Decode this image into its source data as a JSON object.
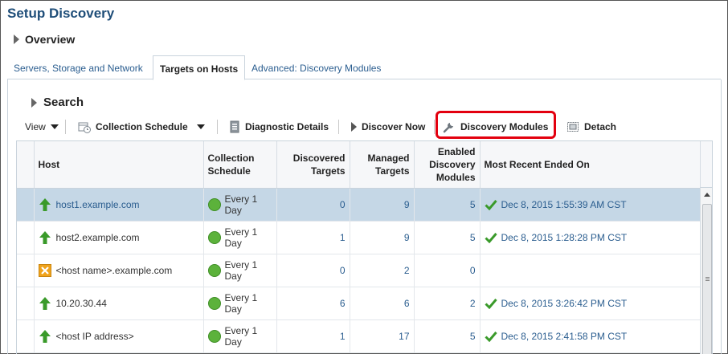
{
  "page": {
    "title": "Setup Discovery"
  },
  "overview": {
    "label": "Overview"
  },
  "tabs": [
    {
      "label": "Servers, Storage and Network"
    },
    {
      "label": "Targets on Hosts"
    },
    {
      "label": "Advanced: Discovery Modules"
    }
  ],
  "search": {
    "label": "Search"
  },
  "toolbar": {
    "view": "View",
    "collection_schedule": "Collection Schedule",
    "diagnostic_details": "Diagnostic Details",
    "discover_now": "Discover Now",
    "discovery_modules": "Discovery Modules",
    "detach": "Detach"
  },
  "table": {
    "headers": {
      "host": "Host",
      "schedule_1": "Collection",
      "schedule_2": "Schedule",
      "discovered_1": "Discovered",
      "discovered_2": "Targets",
      "managed_1": "Managed",
      "managed_2": "Targets",
      "enabled_1": "Enabled",
      "enabled_2": "Discovery",
      "enabled_3": "Modules",
      "recent": "Most Recent Ended On"
    },
    "rows": [
      {
        "status": "up",
        "host": "host1.example.com",
        "schedule_1": "Every 1",
        "schedule_2": "Day",
        "discovered": "0",
        "managed": "9",
        "enabled": "5",
        "recent": "Dec 8, 2015 1:55:39 AM CST"
      },
      {
        "status": "up",
        "host": "host2.example.com",
        "schedule_1": "Every 1",
        "schedule_2": "Day",
        "discovered": "1",
        "managed": "9",
        "enabled": "5",
        "recent": "Dec 8, 2015 1:28:28 PM CST"
      },
      {
        "status": "unknown",
        "host": "<host name>.example.com",
        "schedule_1": "Every 1",
        "schedule_2": "Day",
        "discovered": "0",
        "managed": "2",
        "enabled": "0",
        "recent": ""
      },
      {
        "status": "up",
        "host": "10.20.30.44",
        "schedule_1": "Every 1",
        "schedule_2": "Day",
        "discovered": "6",
        "managed": "6",
        "enabled": "2",
        "recent": "Dec 8, 2015 3:26:42 PM CST"
      },
      {
        "status": "up",
        "host": "<host IP address>",
        "schedule_1": "Every 1",
        "schedule_2": "Day",
        "discovered": "1",
        "managed": "17",
        "enabled": "5",
        "recent": "Dec 8, 2015 2:41:58 PM CST"
      }
    ]
  },
  "colors": {
    "accent": "#1f4e79",
    "link": "#2a5d8f",
    "selected_row": "#c5d7e6",
    "status_up": "#3a9a2a",
    "schedule_ok": "#5cb23b",
    "highlight": "#e3000f",
    "warning": "#f0a31c"
  },
  "icons": {
    "up": "green-up-arrow-icon",
    "unknown": "yellow-x-status-icon",
    "check": "green-check-icon",
    "schedule": "green-circle-icon"
  }
}
